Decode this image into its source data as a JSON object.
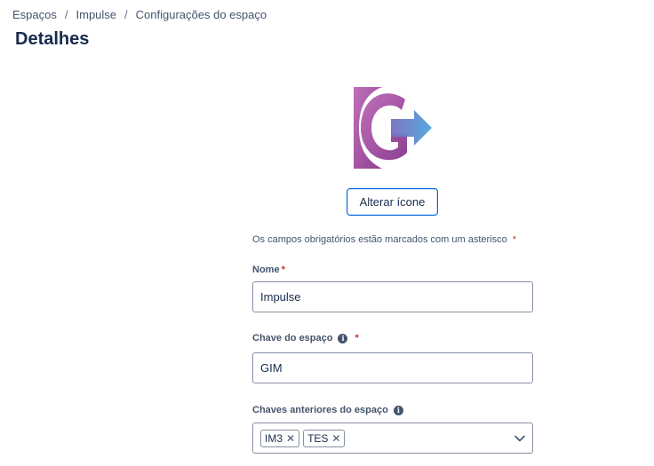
{
  "breadcrumb": {
    "items": [
      "Espaços",
      "Impulse",
      "Configurações do espaço"
    ],
    "separator": "/"
  },
  "page": {
    "title": "Detalhes"
  },
  "icon_section": {
    "logo_icon": "space-logo-icon",
    "change_icon_label": "Alterar ícone"
  },
  "form": {
    "required_note": "Os campos obrigatórios estão marcados com um asterisco",
    "required_mark": "*",
    "name": {
      "label": "Nome",
      "value": "Impulse"
    },
    "space_key": {
      "label": "Chave do espaço",
      "value": "GIM",
      "info_icon": "info-icon"
    },
    "previous_keys": {
      "label": "Chaves anteriores do espaço",
      "info_icon": "info-icon",
      "tags": [
        "IM3",
        "TES"
      ],
      "remove_glyph": "✕",
      "dropdown_icon": "chevron-down-icon"
    }
  },
  "colors": {
    "accent": "#0c66e4",
    "required": "#c9372c",
    "logo_purple": "#a0479a",
    "logo_blue": "#4a9fd8"
  }
}
